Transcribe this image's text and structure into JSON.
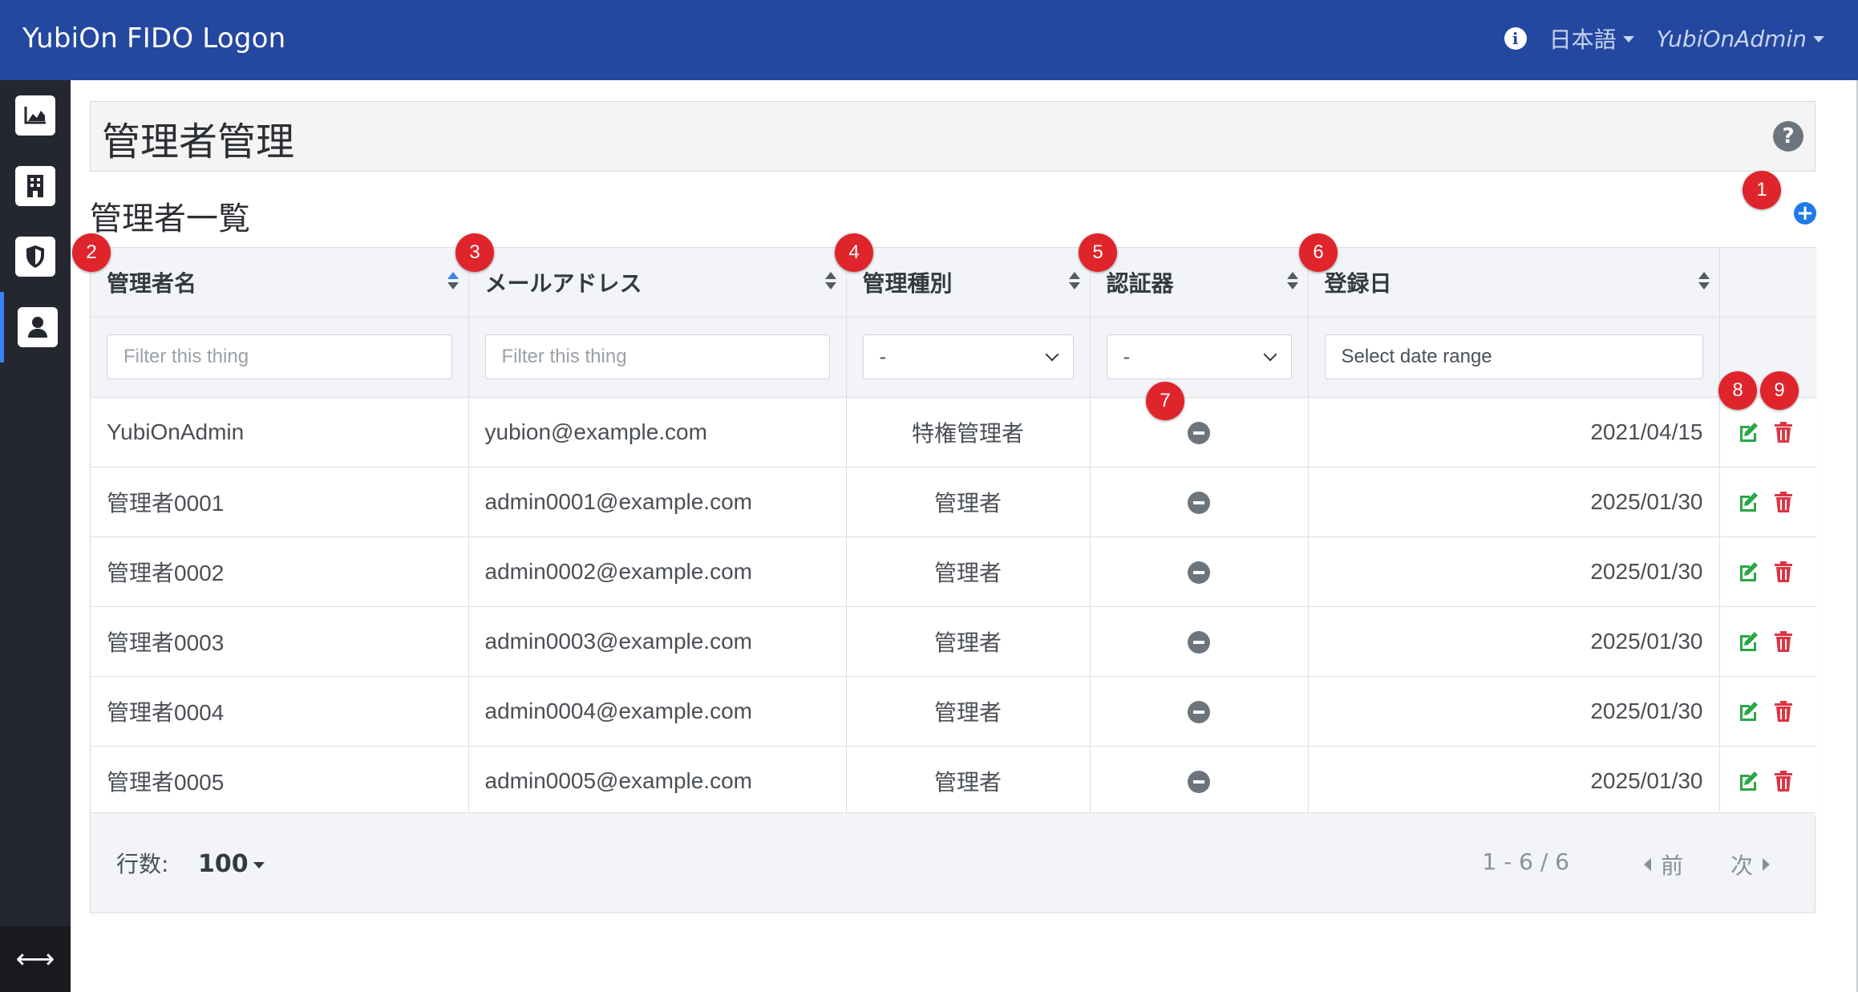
{
  "navbar": {
    "brand": "YubiOn FIDO Logon",
    "language": "日本語",
    "user": "YubiOnAdmin",
    "info_icon": "info-circle-icon"
  },
  "sidebar": {
    "items": [
      {
        "icon": "chart-area-icon",
        "active": false
      },
      {
        "icon": "building-icon",
        "active": false
      },
      {
        "icon": "shield-icon",
        "active": false
      },
      {
        "icon": "user-icon",
        "active": true
      }
    ],
    "footer_icon": "arrows-h-icon"
  },
  "page": {
    "title": "管理者管理",
    "help_icon": "question-circle-icon",
    "section_title": "管理者一覧",
    "add_icon": "plus-circle-icon"
  },
  "table": {
    "columns": [
      "管理者名",
      "メールアドレス",
      "管理種別",
      "認証器",
      "登録日"
    ],
    "filters": {
      "name_placeholder": "Filter this thing",
      "email_placeholder": "Filter this thing",
      "type_value": "-",
      "auth_value": "-",
      "date_placeholder": "Select date range"
    },
    "rows": [
      {
        "name": "YubiOnAdmin",
        "email": "yubion@example.com",
        "type": "特権管理者",
        "date": "2021/04/15"
      },
      {
        "name": "管理者0001",
        "email": "admin0001@example.com",
        "type": "管理者",
        "date": "2025/01/30"
      },
      {
        "name": "管理者0002",
        "email": "admin0002@example.com",
        "type": "管理者",
        "date": "2025/01/30"
      },
      {
        "name": "管理者0003",
        "email": "admin0003@example.com",
        "type": "管理者",
        "date": "2025/01/30"
      },
      {
        "name": "管理者0004",
        "email": "admin0004@example.com",
        "type": "管理者",
        "date": "2025/01/30"
      },
      {
        "name": "管理者0005",
        "email": "admin0005@example.com",
        "type": "管理者",
        "date": "2025/01/30"
      }
    ]
  },
  "footer": {
    "rows_label": "行数:",
    "rows_value": "100",
    "page_info": "1 - 6 / 6",
    "prev": "前",
    "next": "次"
  },
  "markers": [
    "1",
    "2",
    "3",
    "4",
    "5",
    "6",
    "7",
    "8",
    "9"
  ],
  "colors": {
    "navbar": "#2447a0",
    "sidebar": "#24272f",
    "marker": "#e0242b",
    "edit": "#28a745",
    "delete": "#dc3545",
    "add": "#1f7ae8"
  }
}
